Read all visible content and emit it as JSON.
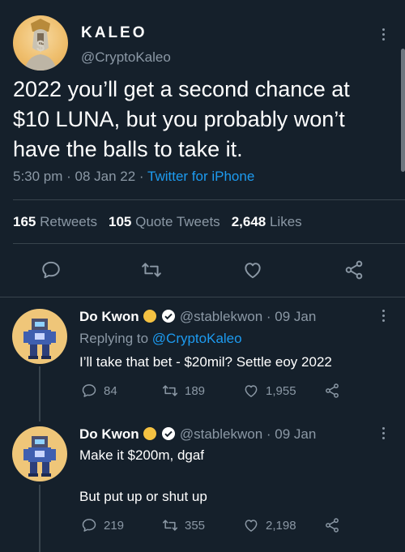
{
  "main_tweet": {
    "author_name": "KALEO",
    "author_handle": "@CryptoKaleo",
    "avatar_icon": "kaleo-avatar-icon",
    "line1": "2022 you’ll get a second chance at",
    "line2": "$10 LUNA, but you probably won’t",
    "line3": "have the balls to take it.",
    "time": "5:30 pm · 08 Jan 22 · ",
    "source": "Twitter for iPhone",
    "stats": {
      "retweets_count": "165",
      "retweets_label": "Retweets",
      "quotes_count": "105",
      "quotes_label": "Quote Tweets",
      "likes_count": "2,648",
      "likes_label": "Likes"
    },
    "actions": [
      "reply-icon",
      "retweet-icon",
      "like-icon",
      "share-icon"
    ]
  },
  "replies": [
    {
      "name": "Do Kwon",
      "handle_date": "@stablekwon · 09 Jan",
      "replying_prefix": "Replying to ",
      "replying_to": "@CryptoKaleo",
      "text": "I’ll take that bet - $20mil? Settle eoy 2022",
      "reply_count": "84",
      "retweet_count": "189",
      "like_count": "1,955"
    },
    {
      "name": "Do Kwon",
      "handle_date": "@stablekwon · 09 Jan",
      "text_line1": "Make it $200m, dgaf",
      "text_line2": "But put up or shut up",
      "reply_count": "219",
      "retweet_count": "355",
      "like_count": "2,198"
    }
  ],
  "colors": {
    "background": "#15202b",
    "muted": "#8b98a5",
    "link": "#1d9bf0",
    "divider": "#38444d",
    "sun_badge": "#f5c242"
  }
}
